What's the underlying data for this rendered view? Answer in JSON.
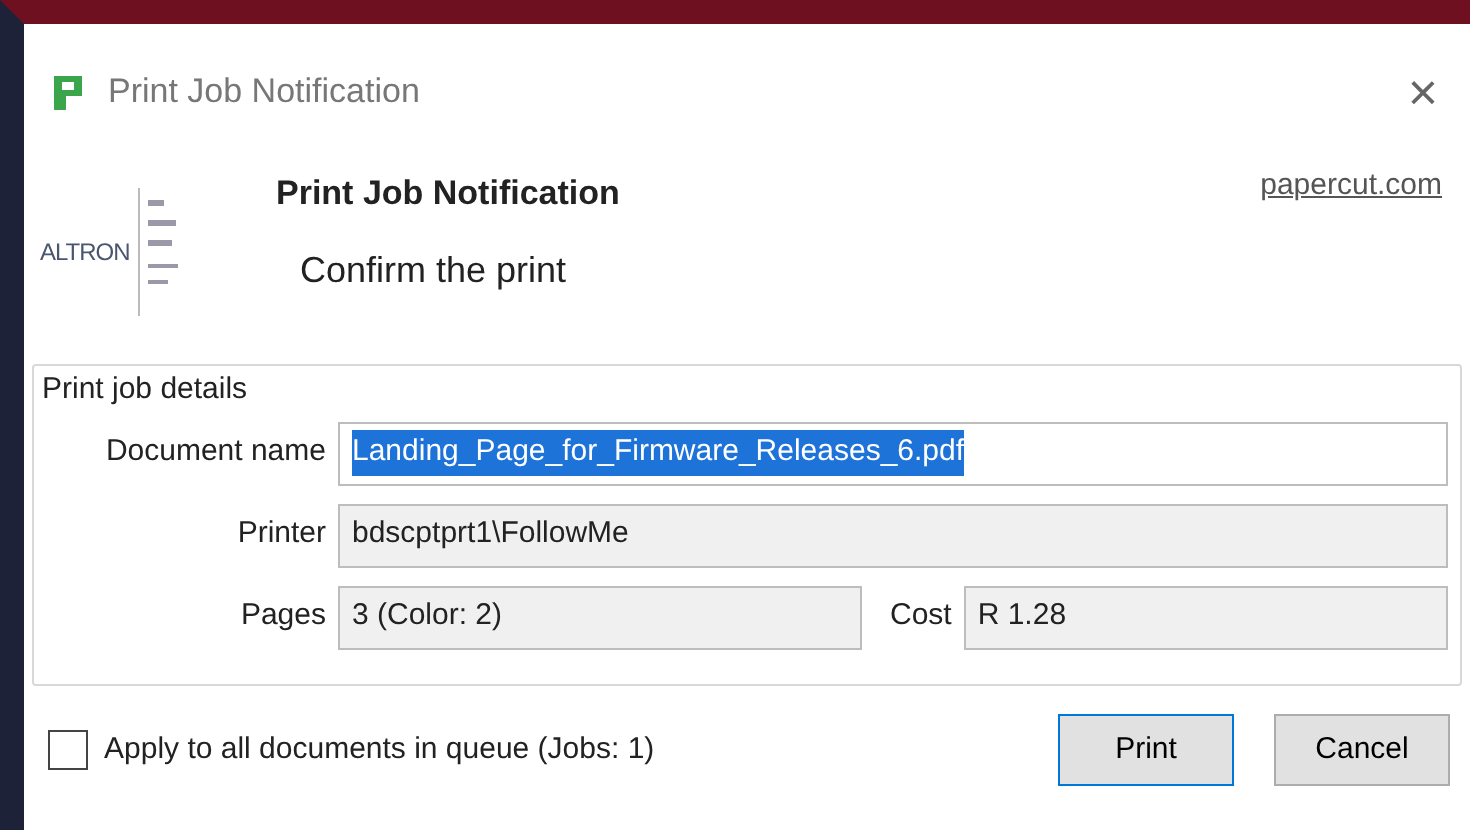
{
  "window": {
    "title": "Print Job Notification",
    "close": "×"
  },
  "header": {
    "logo_text": "ALTRON",
    "title": "Print Job Notification",
    "subtitle": "Confirm the print",
    "link": "papercut.com"
  },
  "details": {
    "legend": "Print job details",
    "fields": [
      {
        "label": "Document name",
        "value": "Landing_Page_for_Firmware_Releases_6.pdf",
        "selected": true
      },
      {
        "label": "Printer",
        "value": "bdscptprt1\\FollowMe",
        "selected": false
      }
    ],
    "pages": {
      "label": "Pages",
      "value": "3  (Color: 2)"
    },
    "cost": {
      "label": "Cost",
      "value": "R 1.28"
    }
  },
  "apply_all": {
    "label": "Apply to all documents in queue (Jobs: 1)",
    "checked": false
  },
  "buttons": [
    {
      "label": "Print",
      "kind": "primary"
    },
    {
      "label": "Cancel",
      "kind": "secondary"
    }
  ]
}
